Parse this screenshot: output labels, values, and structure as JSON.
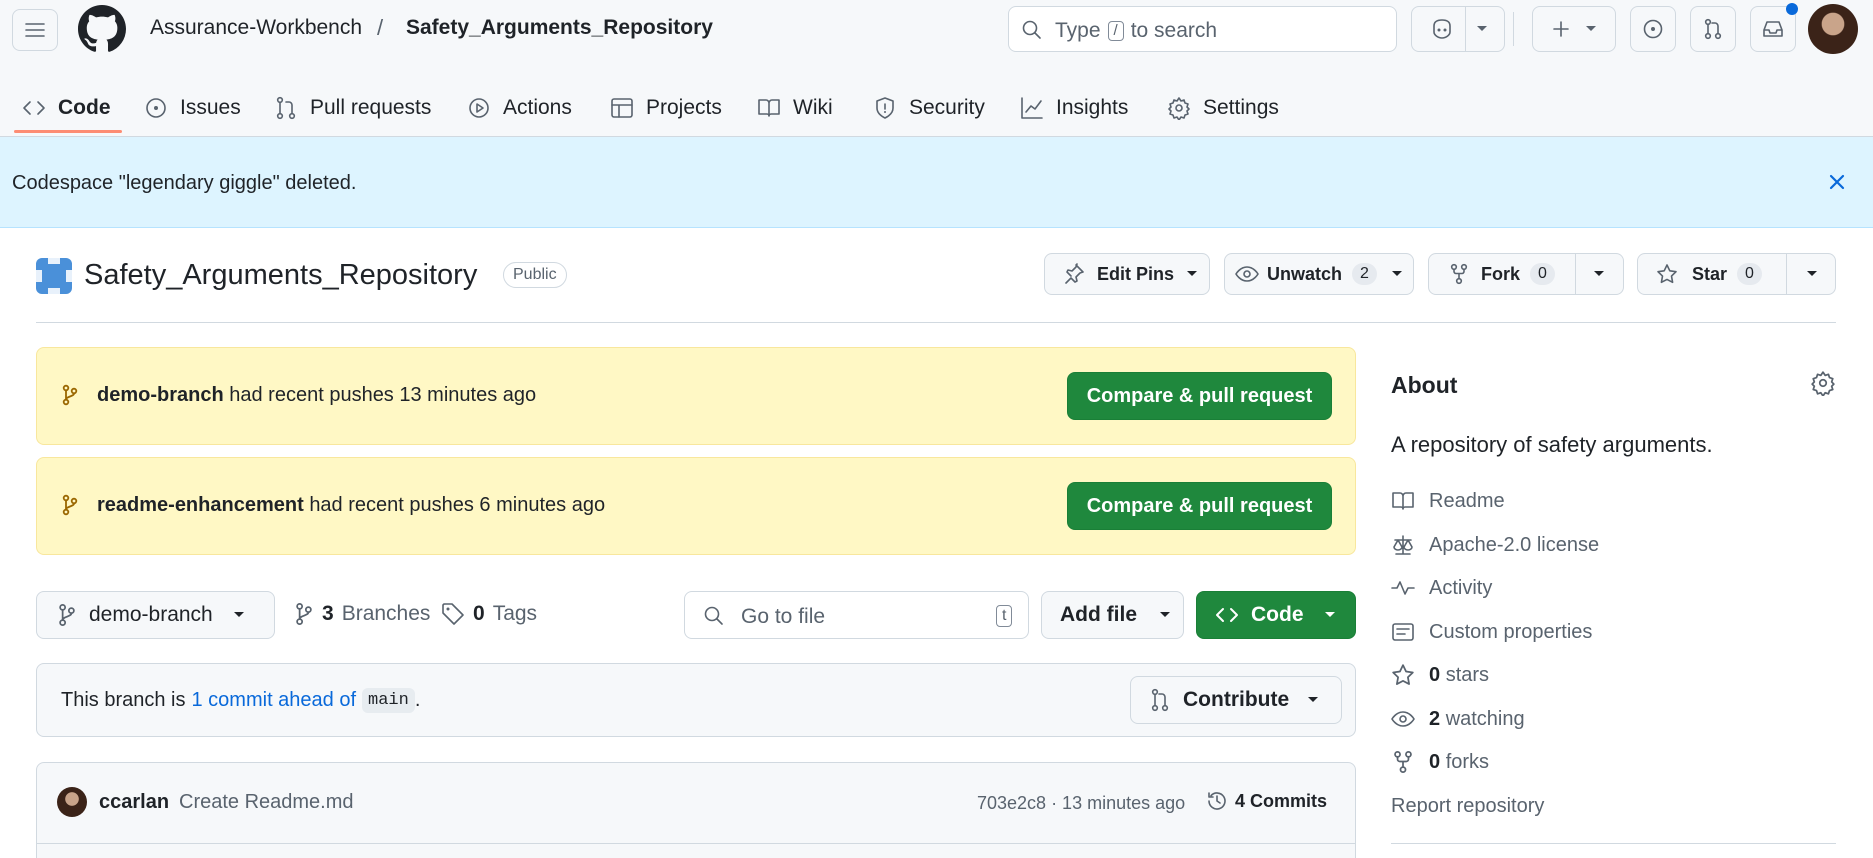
{
  "header": {
    "owner": "Assurance-Workbench",
    "separator": "/",
    "repo": "Safety_Arguments_Repository",
    "search_prefix": "Type",
    "search_key": "/",
    "search_suffix": "to search"
  },
  "tabs": [
    {
      "label": "Code",
      "icon": "code-icon"
    },
    {
      "label": "Issues",
      "icon": "issue-icon"
    },
    {
      "label": "Pull requests",
      "icon": "pull-request-icon"
    },
    {
      "label": "Actions",
      "icon": "play-icon"
    },
    {
      "label": "Projects",
      "icon": "table-icon"
    },
    {
      "label": "Wiki",
      "icon": "book-icon"
    },
    {
      "label": "Security",
      "icon": "shield-icon"
    },
    {
      "label": "Insights",
      "icon": "graph-icon"
    },
    {
      "label": "Settings",
      "icon": "gear-icon"
    }
  ],
  "flash": {
    "message": "Codespace \"legendary giggle\" deleted."
  },
  "repo": {
    "title": "Safety_Arguments_Repository",
    "visibility": "Public",
    "edit_pins": "Edit Pins",
    "unwatch": "Unwatch",
    "unwatch_count": "2",
    "fork": "Fork",
    "fork_count": "0",
    "star": "Star",
    "star_count": "0"
  },
  "banners": [
    {
      "branch": "demo-branch",
      "text": "had recent pushes 13 minutes ago",
      "button": "Compare & pull request"
    },
    {
      "branch": "readme-enhancement",
      "text": "had recent pushes 6 minutes ago",
      "button": "Compare & pull request"
    }
  ],
  "filenav": {
    "branch": "demo-branch",
    "branches_count": "3",
    "branches_label": "Branches",
    "tags_count": "0",
    "tags_label": "Tags",
    "goto_placeholder": "Go to file",
    "goto_key": "t",
    "add_file": "Add file",
    "code": "Code"
  },
  "ahead": {
    "prefix": "This branch is",
    "link": "1 commit ahead of",
    "base": "main",
    "suffix": ".",
    "contribute": "Contribute"
  },
  "commit": {
    "author": "ccarlan",
    "message": "Create Readme.md",
    "meta": "703e2c8 · 13 minutes ago",
    "commits": "4 Commits"
  },
  "about": {
    "heading": "About",
    "description": "A repository of safety arguments.",
    "items": [
      {
        "icon": "book-icon",
        "label": "Readme",
        "count": ""
      },
      {
        "icon": "law-icon",
        "label": "Apache-2.0 license",
        "count": ""
      },
      {
        "icon": "pulse-icon",
        "label": "Activity",
        "count": ""
      },
      {
        "icon": "note-icon",
        "label": "Custom properties",
        "count": ""
      },
      {
        "icon": "star-icon",
        "label": "stars",
        "count": "0"
      },
      {
        "icon": "eye-icon",
        "label": "watching",
        "count": "2"
      },
      {
        "icon": "fork-icon",
        "label": "forks",
        "count": "0"
      }
    ],
    "report": "Report repository"
  },
  "colors": {
    "accent_green": "#1f883d",
    "tab_underline": "#fd8c73",
    "flash_bg": "#ddf4ff",
    "banner_bg": "#fff8c5",
    "link": "#0969da"
  }
}
